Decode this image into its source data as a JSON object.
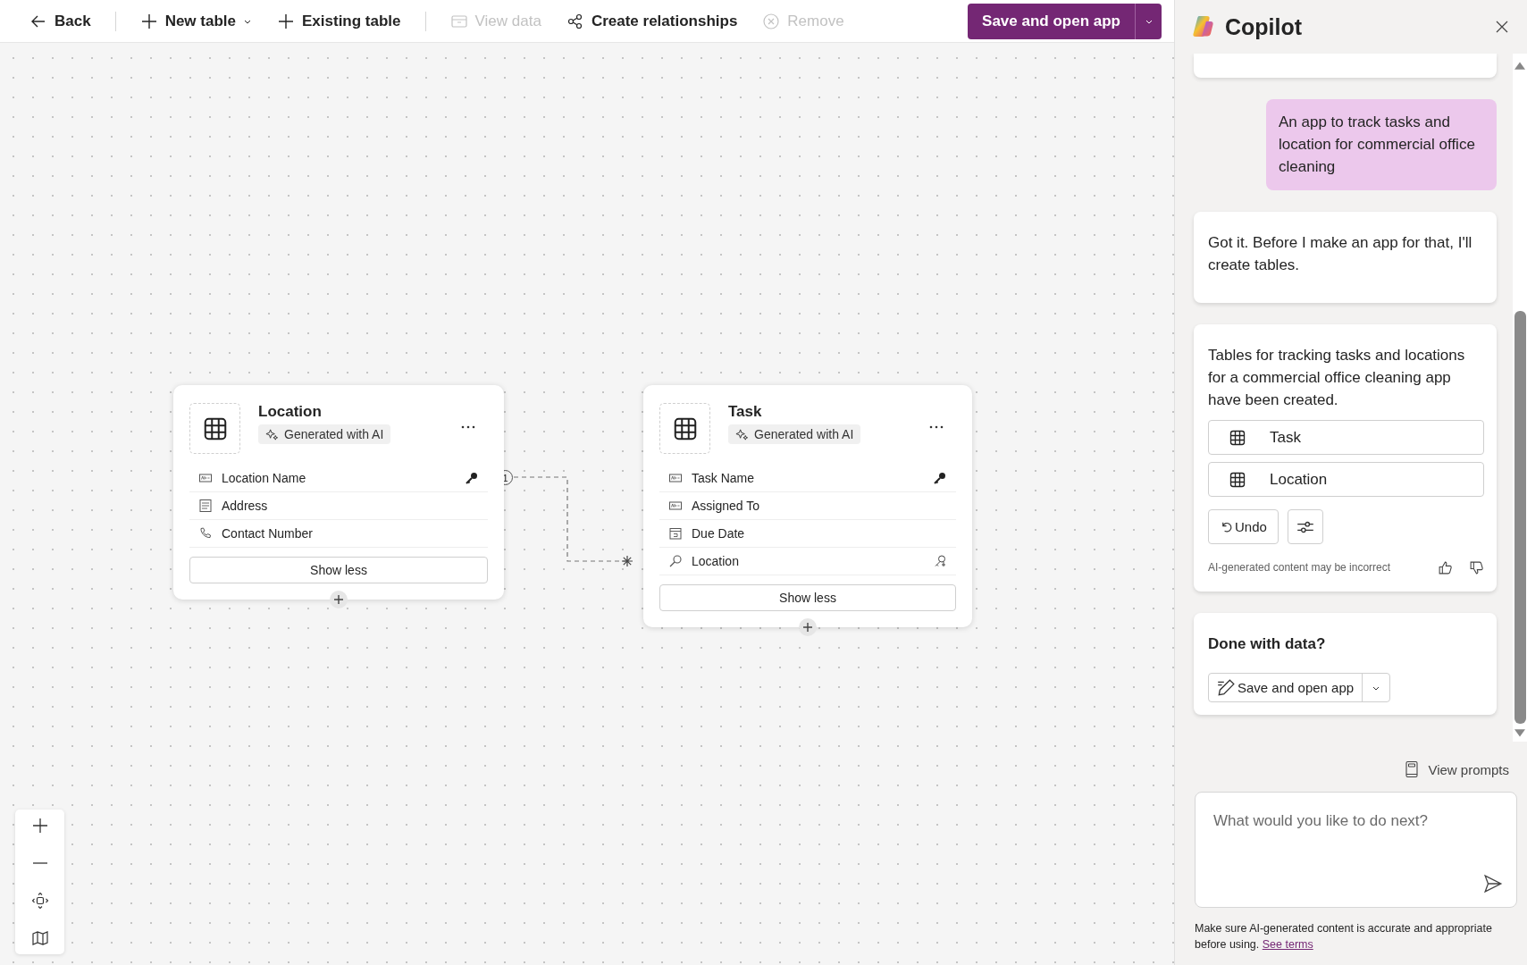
{
  "toolbar": {
    "groups": [
      [
        {
          "label": "Back",
          "disabled": false,
          "menu": false
        }
      ],
      [
        {
          "label": "New table",
          "disabled": false,
          "menu": true
        },
        {
          "label": "Existing table",
          "disabled": false,
          "menu": false
        }
      ],
      [
        {
          "label": "View data",
          "disabled": true,
          "menu": false
        },
        {
          "label": "Create relationships",
          "disabled": false,
          "menu": false
        },
        {
          "label": "Remove",
          "disabled": true,
          "menu": false
        }
      ]
    ],
    "primary": {
      "label": "Save and open app"
    }
  },
  "canvas": {
    "tables": [
      {
        "name": "Location",
        "badge": "Generated with AI",
        "fields": [
          {
            "name": "Location Name",
            "kind": "text",
            "primary_key": true
          },
          {
            "name": "Address",
            "kind": "multiline",
            "primary_key": false
          },
          {
            "name": "Contact Number",
            "kind": "phone",
            "primary_key": false
          }
        ],
        "toggle": "Show less"
      },
      {
        "name": "Task",
        "badge": "Generated with AI",
        "fields": [
          {
            "name": "Task Name",
            "kind": "text",
            "primary_key": true
          },
          {
            "name": "Assigned To",
            "kind": "text",
            "primary_key": false
          },
          {
            "name": "Due Date",
            "kind": "date",
            "primary_key": false
          },
          {
            "name": "Location",
            "kind": "lookup",
            "primary_key": false
          }
        ],
        "toggle": "Show less"
      }
    ],
    "relationship": {
      "one_label": "1"
    }
  },
  "copilot": {
    "title": "Copilot",
    "messages": [
      {
        "kind": "user",
        "text": "An app to track tasks and location for commercial office cleaning"
      },
      {
        "kind": "bot",
        "text": "Got it. Before I make an app for that, I'll create tables."
      },
      {
        "kind": "tables",
        "text": "Tables for tracking tasks and locations for a commercial office cleaning app have been created.",
        "tables": [
          "Task",
          "Location"
        ],
        "undo": "Undo",
        "disclaimer": "AI-generated content may be incorrect"
      },
      {
        "kind": "action",
        "title": "Done with data?",
        "button": "Save and open app"
      }
    ],
    "view_prompts": "View prompts",
    "input": {
      "placeholder": "What would you like to do next?"
    },
    "footer": {
      "text": "Make sure AI-generated content is accurate and appropriate before using.",
      "link": "See terms"
    }
  }
}
